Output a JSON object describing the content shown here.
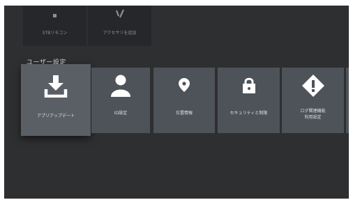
{
  "top_row": {
    "items": [
      {
        "label": "STBリモコン"
      },
      {
        "label": "アクセサリを追加"
      }
    ]
  },
  "section": {
    "title": "ユーザー設定"
  },
  "tiles": [
    {
      "label": "アプリアップデート",
      "icon": "download-icon"
    },
    {
      "label": "ID設定",
      "icon": "person-icon"
    },
    {
      "label": "位置情報",
      "icon": "location-pin-icon"
    },
    {
      "label": "セキュリティと制限",
      "icon": "lock-icon"
    },
    {
      "label_line1": "ログ関連機能",
      "label_line2": "利用設定",
      "icon": "warning-diamond-icon"
    }
  ],
  "colors": {
    "background": "#2e2f31",
    "tile": "#4e5359",
    "tile_focused": "#5a5f65",
    "text": "#dfe2e5"
  }
}
